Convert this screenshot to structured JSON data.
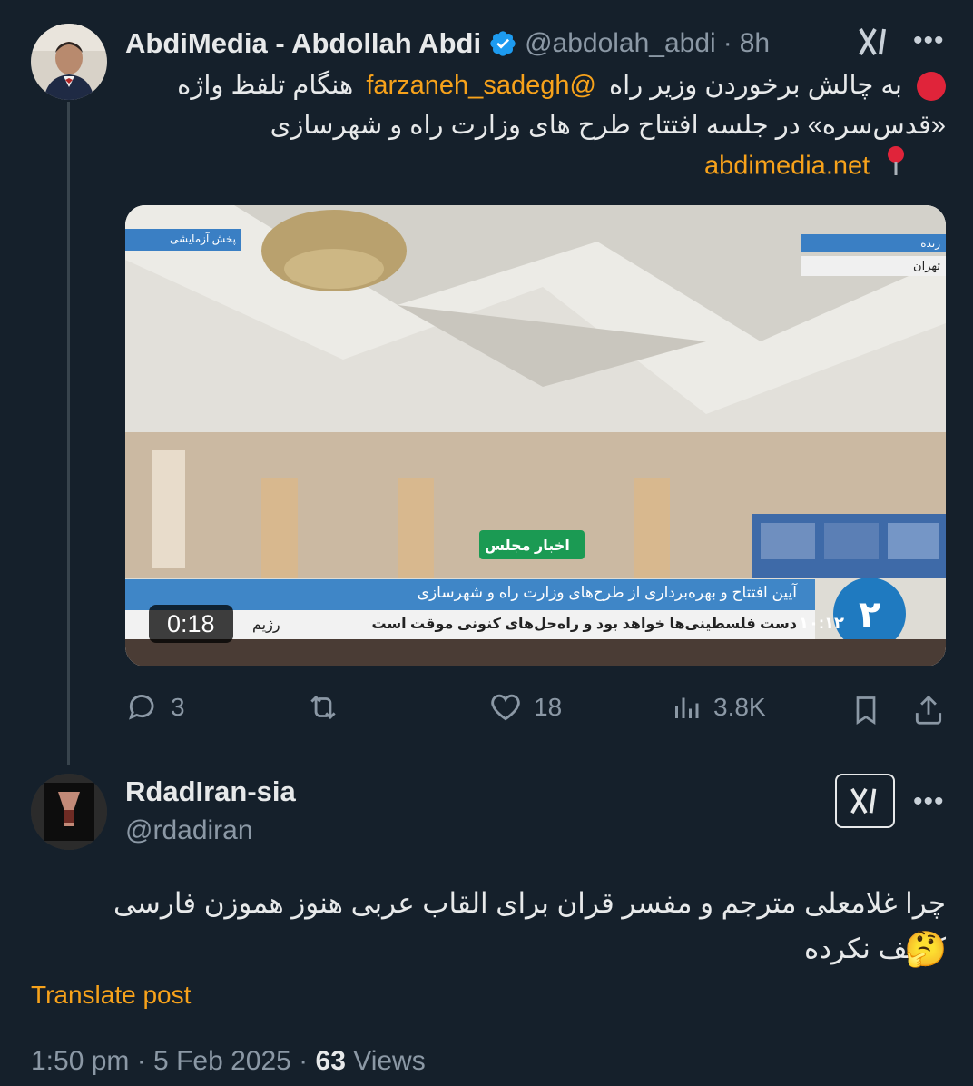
{
  "main_tweet": {
    "author_name": "AbdiMedia - Abdollah Abdi",
    "handle": "@abdolah_abdi",
    "separator": "·",
    "time": "8h",
    "text_line1_prefix": "به چالش برخوردن وزیر راه",
    "mention": "@farzaneh_sadegh",
    "text_line1_suffix": "هنگام تلفظ واژه",
    "text_line2": "«قدس‌سره» در جلسه افتتاح طرح های وزارت راه و شهرسازی",
    "link": "abdimedia.net",
    "video": {
      "duration": "0:18",
      "overlay_top_left": "پخش آزمایشی",
      "overlay_live": "زنده",
      "overlay_city": "تهران",
      "news_badge": "اخبار مجلس",
      "ticker_title": "آیین افتتاح و بهره‌برداری از طرح‌های وزارت راه و شهرسازی",
      "ticker_news": "دست فلسطینی‌ها خواهد بود و راه‌حل‌های کنونی موقت است",
      "ticker_left": "رژیم",
      "clock": "۱۰:۱۲",
      "channel_number": "۲"
    },
    "stats": {
      "replies": "3",
      "likes": "18",
      "views": "3.8K"
    }
  },
  "reply_tweet": {
    "author_name": "RdadIran-sia",
    "handle": "@rdadiran",
    "text": "چرا غلامعلی مترجم و مفسر قران برای القاب عربی هنوز هموزن فارسی کشف نکرده",
    "emoji": "🤔",
    "translate_label": "Translate post",
    "timestamp": "1:50 pm · 5 Feb 2025 ·",
    "views_count": "63",
    "views_label": "Views"
  },
  "colors": {
    "background": "#15202b",
    "accent_link": "#f7a21b",
    "muted": "#8b98a5",
    "verified": "#1d9bf0"
  }
}
